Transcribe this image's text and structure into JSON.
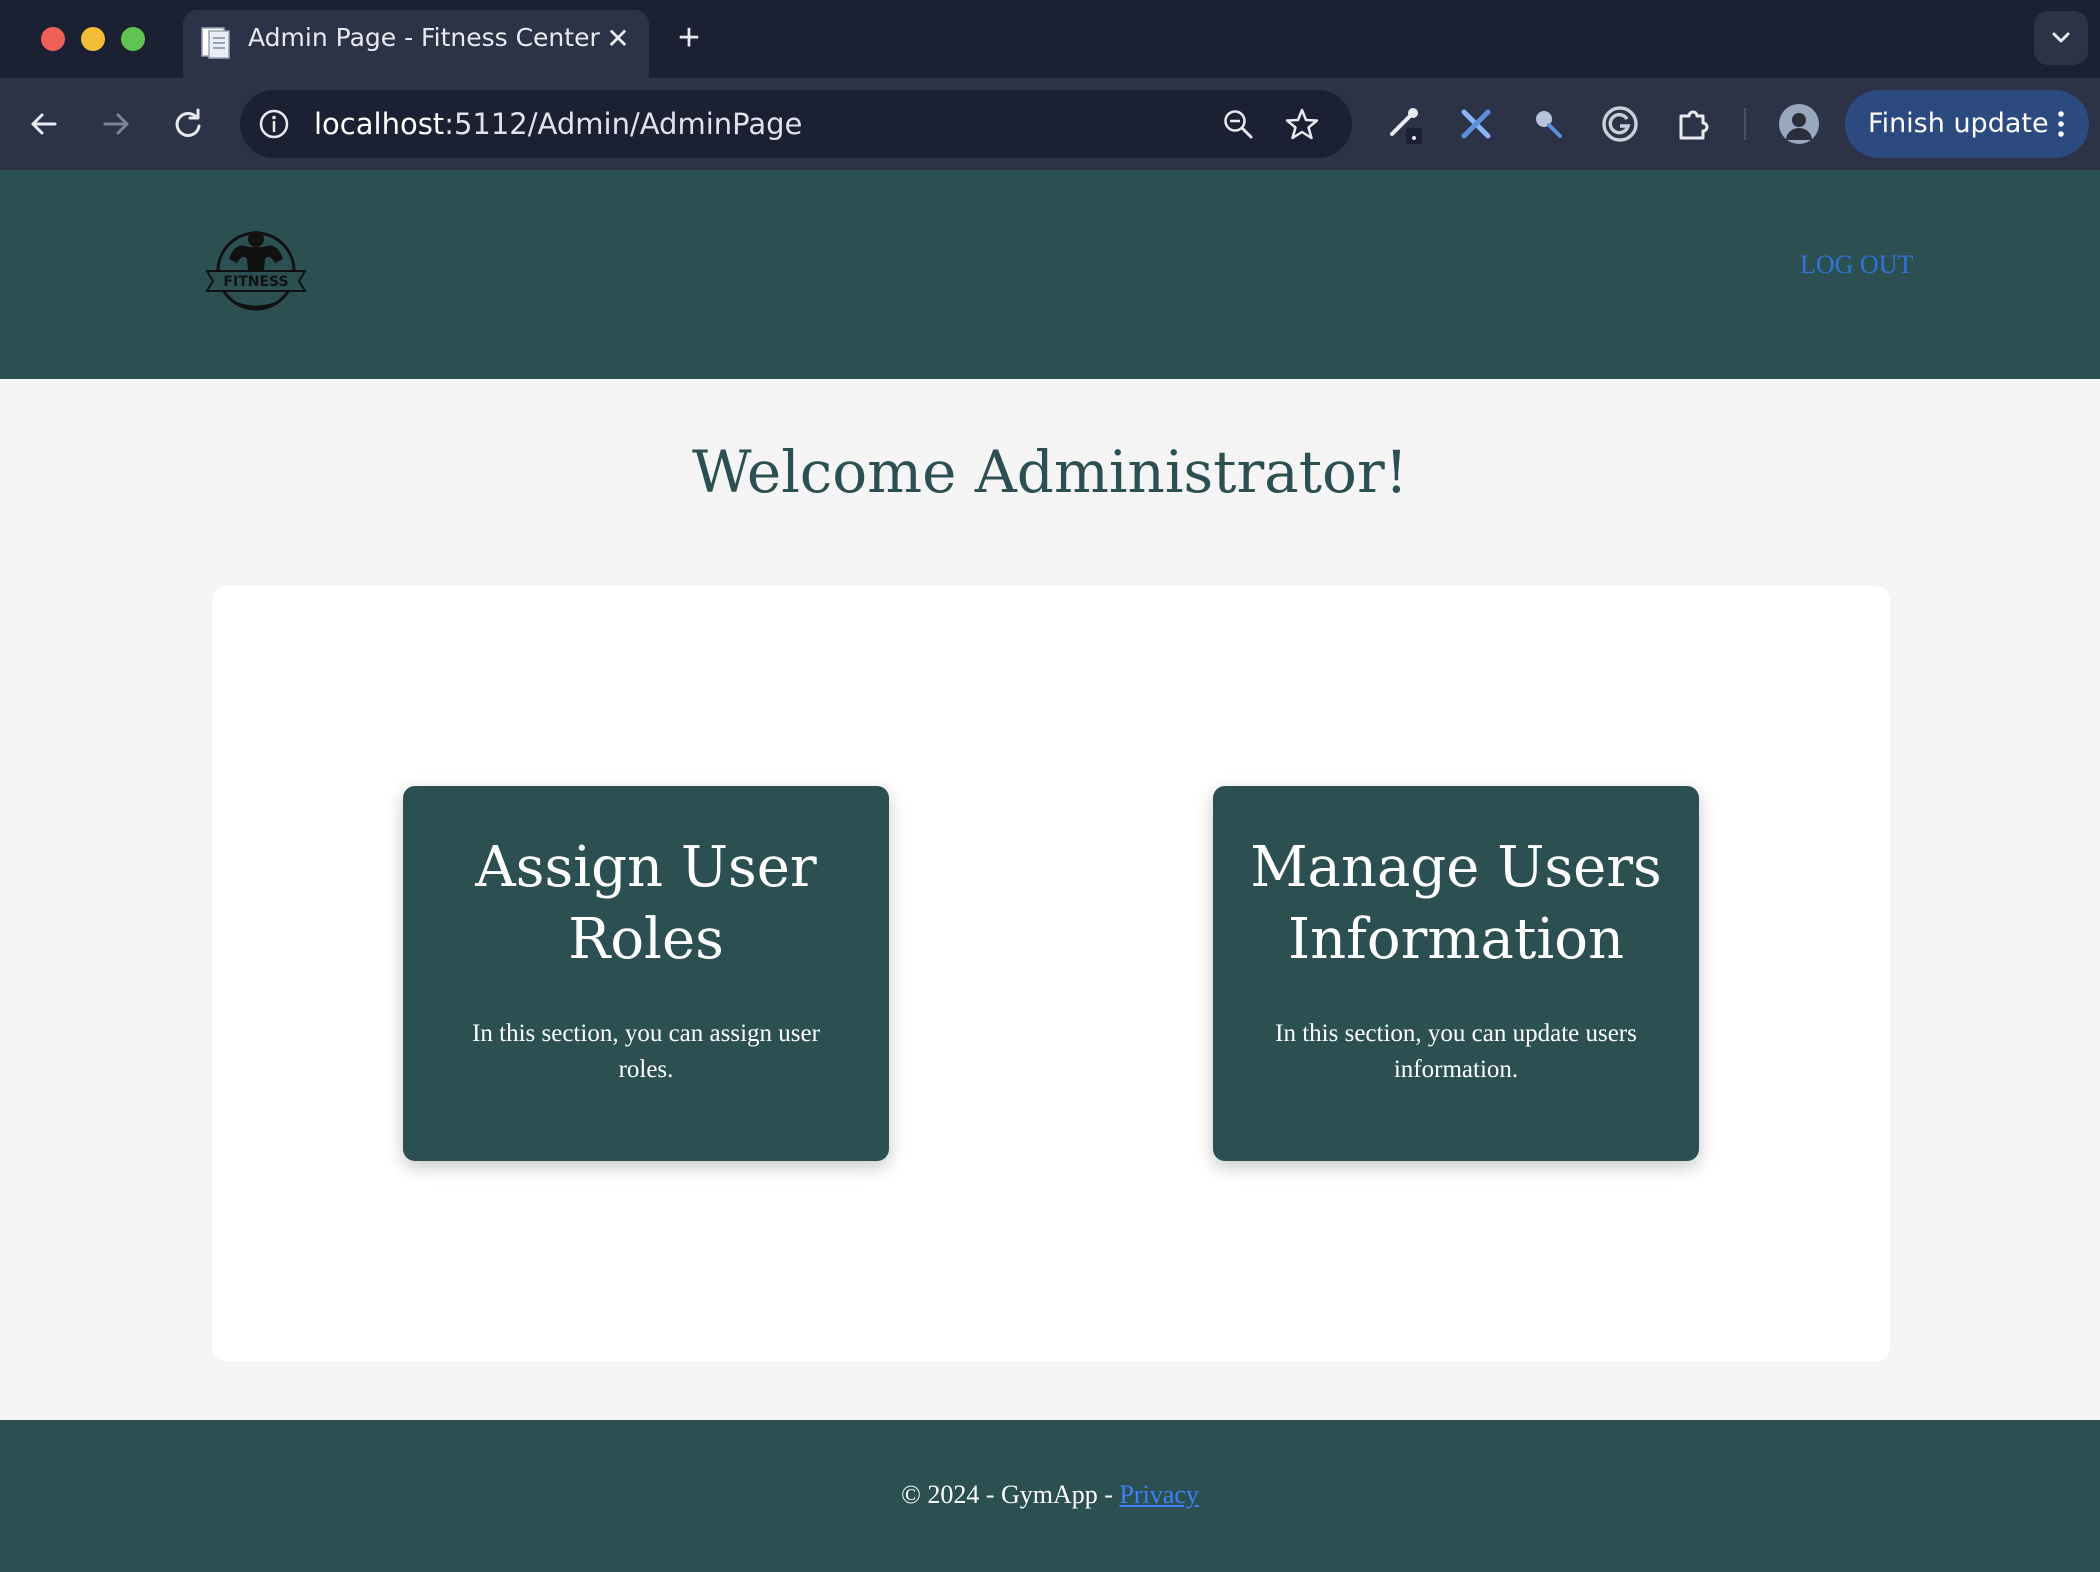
{
  "browser": {
    "tab": {
      "title": "Admin Page - Fitness Center",
      "close_glyph": "✕"
    },
    "new_tab_glyph": "+",
    "address": {
      "host": "localhost",
      "path": ":5112/Admin/AdminPage"
    },
    "finish_update_label": "Finish update",
    "icons": [
      "back-arrow-icon",
      "forward-arrow-icon",
      "reload-icon",
      "site-info-icon",
      "zoom-icon",
      "bookmark-star-icon",
      "eyedropper-extension-icon",
      "tools-extension-icon",
      "search-extension-icon",
      "grammarly-extension-icon",
      "extensions-puzzle-icon",
      "profile-avatar",
      "kebab-menu-icon",
      "tab-search-chevron-icon"
    ]
  },
  "header": {
    "logo_text": "FITNESS",
    "logout_label": "LOG OUT",
    "link_color": "#2f74d8"
  },
  "main": {
    "welcome": "Welcome Administrator!",
    "cards": [
      {
        "title": "Assign User Roles",
        "description": "In this section, you can assign user roles."
      },
      {
        "title": "Manage Users Information",
        "description": "In this section, you can update users information."
      }
    ]
  },
  "footer": {
    "text": "© 2024 - GymApp - ",
    "privacy_label": "Privacy"
  },
  "colors": {
    "brand": "#2c5052",
    "chrome_dark": "#1b2133",
    "chrome": "#2c3347",
    "page_bg": "#f5f5f5"
  }
}
